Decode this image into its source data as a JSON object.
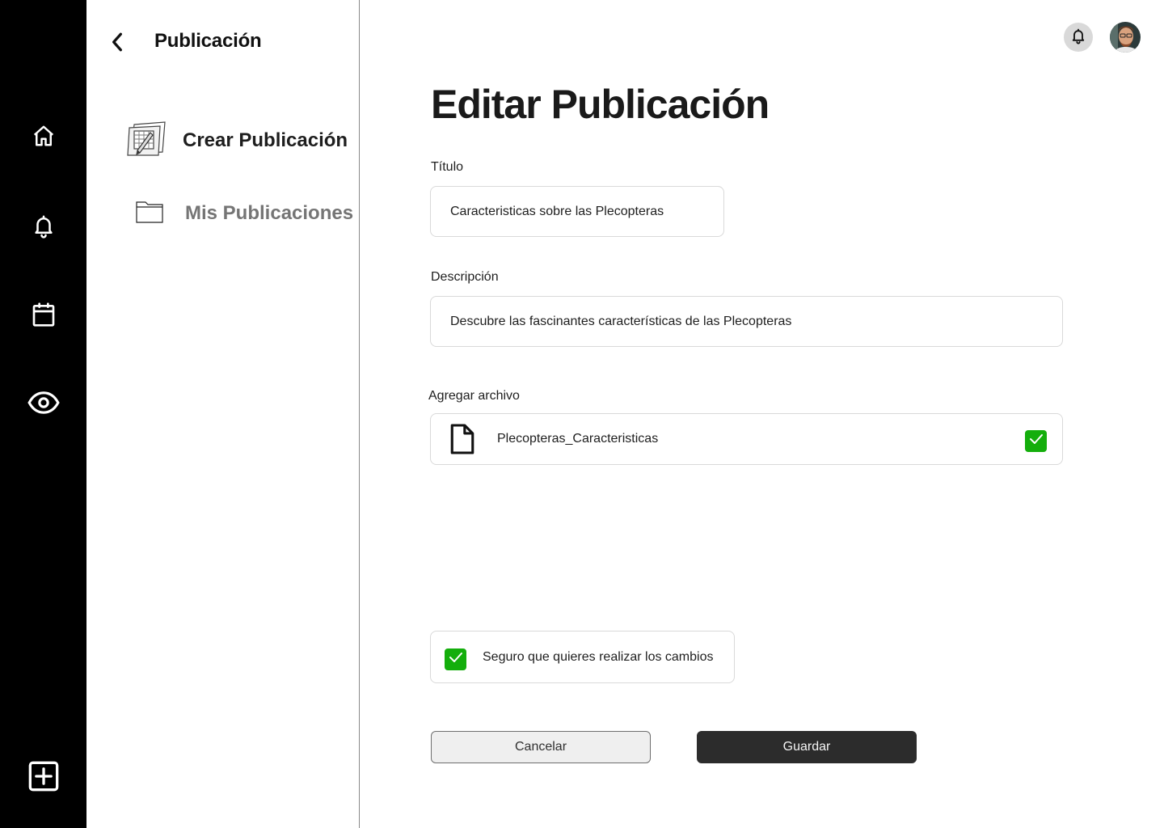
{
  "sidebar": {
    "title": "Publicación",
    "items": [
      {
        "label": "Crear Publicación",
        "icon": "create-publication-icon",
        "active": true
      },
      {
        "label": "Mis Publicaciones",
        "icon": "folder-icon",
        "active": false
      }
    ]
  },
  "rail": {
    "icons": [
      "home-icon",
      "bell-icon",
      "calendar-icon",
      "eye-icon",
      "add-square-icon"
    ]
  },
  "header": {
    "icons": [
      "notification-bell-icon",
      "user-avatar"
    ]
  },
  "main": {
    "title": "Editar Publicación",
    "title_field": {
      "label": "Título",
      "value": "Caracteristicas sobre las Plecopteras"
    },
    "description_field": {
      "label": "Descripción",
      "value": "Descubre las fascinantes características de las Plecopteras"
    },
    "file": {
      "label": "Agregar archivo",
      "name": "Plecopteras_Caracteristicas",
      "checked": true
    },
    "confirm": {
      "text": "Seguro que quieres realizar los cambios",
      "checked": true
    },
    "cancel_label": "Cancelar",
    "save_label": "Guardar"
  },
  "colors": {
    "rail": "#000000",
    "check": "#14ae0c",
    "primary_button": "#2c2c2c",
    "secondary_text": "#757575"
  }
}
